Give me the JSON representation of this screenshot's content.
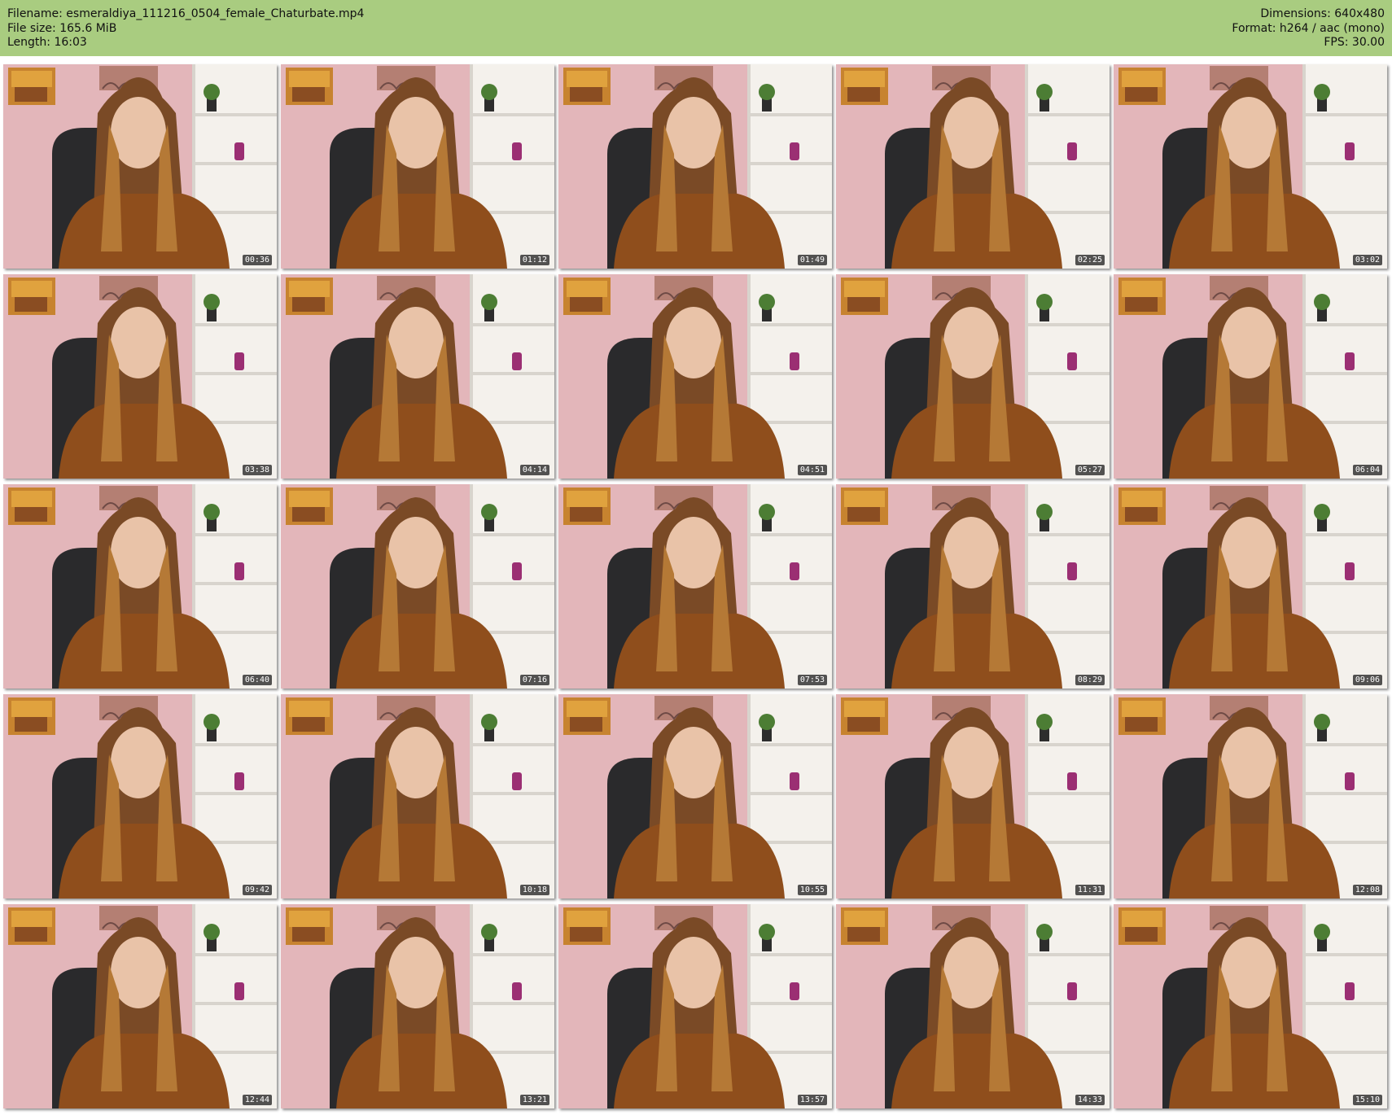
{
  "info": {
    "filename": "Filename: esmeraldiya_111216_0504_female_Chaturbate.mp4",
    "filesize": "File size: 165.6 MiB",
    "length": "Length: 16:03",
    "dimensions": "Dimensions: 640x480",
    "format": "Format: h264 / aac (mono)",
    "fps": "FPS: 30.00"
  },
  "colors": {
    "header_bg": "#a9cc80",
    "wall": "#e3b6ba",
    "shelf": "#f4f1ec",
    "robe": "#8f4e1c",
    "hair": "#7a4a26",
    "chair": "#2a2a2c"
  },
  "thumbnails": [
    {
      "timestamp": "00:36"
    },
    {
      "timestamp": "01:12"
    },
    {
      "timestamp": "01:49"
    },
    {
      "timestamp": "02:25"
    },
    {
      "timestamp": "03:02"
    },
    {
      "timestamp": "03:38"
    },
    {
      "timestamp": "04:14"
    },
    {
      "timestamp": "04:51"
    },
    {
      "timestamp": "05:27"
    },
    {
      "timestamp": "06:04"
    },
    {
      "timestamp": "06:40"
    },
    {
      "timestamp": "07:16"
    },
    {
      "timestamp": "07:53"
    },
    {
      "timestamp": "08:29"
    },
    {
      "timestamp": "09:06"
    },
    {
      "timestamp": "09:42"
    },
    {
      "timestamp": "10:18"
    },
    {
      "timestamp": "10:55"
    },
    {
      "timestamp": "11:31"
    },
    {
      "timestamp": "12:08"
    },
    {
      "timestamp": "12:44"
    },
    {
      "timestamp": "13:21"
    },
    {
      "timestamp": "13:57"
    },
    {
      "timestamp": "14:33"
    },
    {
      "timestamp": "15:10"
    }
  ]
}
